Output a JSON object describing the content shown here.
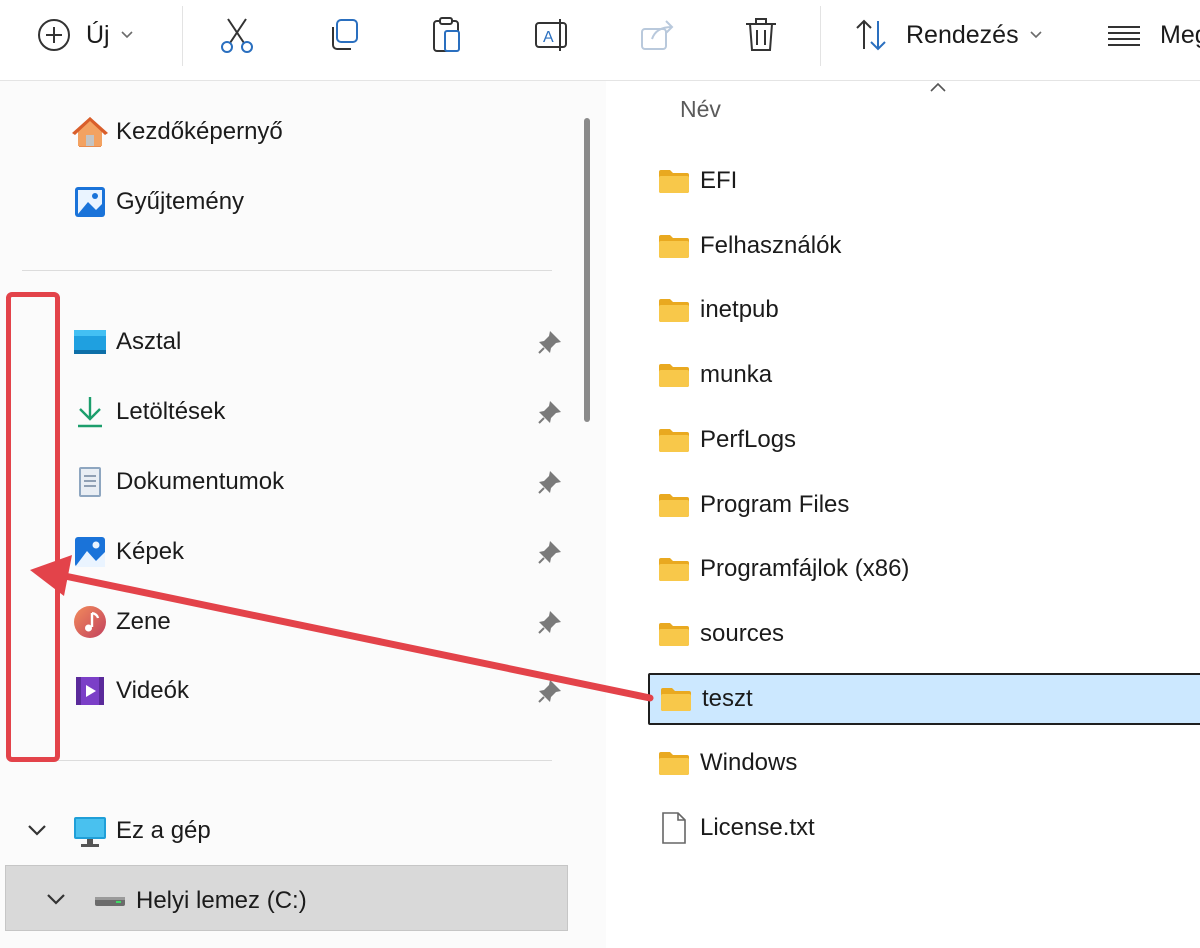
{
  "toolbar": {
    "new_label": "Új",
    "sort_label": "Rendezés",
    "view_label": "Meg",
    "icons": [
      "add-icon",
      "cut-icon",
      "copy-icon",
      "paste-icon",
      "rename-icon",
      "share-icon",
      "delete-icon",
      "sort-icon",
      "view-icon"
    ]
  },
  "nav": {
    "quick": [
      {
        "label": "Kezdőképernyő",
        "icon": "home-icon"
      },
      {
        "label": "Gyűjtemény",
        "icon": "gallery-icon"
      }
    ],
    "pinned": [
      {
        "label": "Asztal",
        "icon": "desktop-icon"
      },
      {
        "label": "Letöltések",
        "icon": "download-icon"
      },
      {
        "label": "Dokumentumok",
        "icon": "documents-icon"
      },
      {
        "label": "Képek",
        "icon": "pictures-icon"
      },
      {
        "label": "Zene",
        "icon": "music-icon"
      },
      {
        "label": "Videók",
        "icon": "videos-icon"
      }
    ],
    "this_pc": {
      "label": "Ez a gép",
      "icon": "monitor-icon"
    },
    "drive": {
      "label": "Helyi lemez (C:)",
      "icon": "drive-icon"
    }
  },
  "content": {
    "column_header": "Név",
    "files": [
      {
        "name": "EFI",
        "type": "folder"
      },
      {
        "name": "Felhasználók",
        "type": "folder"
      },
      {
        "name": "inetpub",
        "type": "folder"
      },
      {
        "name": "munka",
        "type": "folder"
      },
      {
        "name": "PerfLogs",
        "type": "folder"
      },
      {
        "name": "Program Files",
        "type": "folder"
      },
      {
        "name": "Programfájlok (x86)",
        "type": "folder"
      },
      {
        "name": "sources",
        "type": "folder"
      },
      {
        "name": "teszt",
        "type": "folder",
        "selected": true
      },
      {
        "name": "Windows",
        "type": "folder"
      },
      {
        "name": "License.txt",
        "type": "file"
      }
    ]
  },
  "colors": {
    "folder": "#f8c84a",
    "selection": "#cce8ff",
    "annotation": "#e3434a"
  }
}
